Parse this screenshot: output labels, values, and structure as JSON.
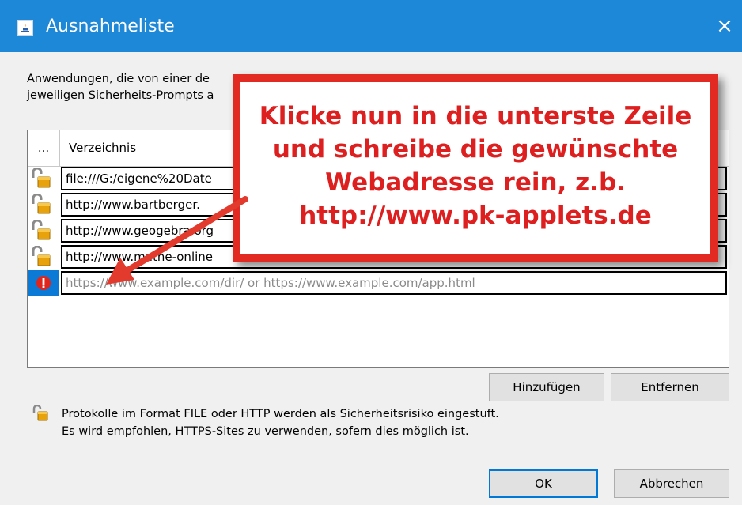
{
  "window": {
    "title": "Ausnahmeliste",
    "close_glyph": "×",
    "app_icon": "java-icon",
    "titlebar_color": "#1e88d8"
  },
  "description": "Anwendungen, die von einer de                                                                 \njeweiligen Sicherheits-Prompts a",
  "table": {
    "columns": [
      "...",
      "Verzeichnis"
    ],
    "rows": [
      {
        "icon": "unlocked-padlock-icon",
        "url": "file:///G:/eigene%20Date"
      },
      {
        "icon": "unlocked-padlock-icon",
        "url": "http://www.bartberger."
      },
      {
        "icon": "unlocked-padlock-icon",
        "url": "http://www.geogebra.org"
      },
      {
        "icon": "unlocked-padlock-icon",
        "url": "http://www.mathe-online"
      }
    ],
    "new_row": {
      "icon": "error-icon",
      "placeholder": "https://www.example.com/dir/ or https://www.example.com/app.html"
    }
  },
  "buttons": {
    "add": "Hinzufügen",
    "remove": "Entfernen",
    "ok": "OK",
    "cancel": "Abbrechen"
  },
  "warning": {
    "icon": "unlocked-padlock-icon",
    "text": "Protokolle im Format FILE oder HTTP werden als Sicherheitsrisiko eingestuft.\nEs wird empfohlen, HTTPS-Sites zu verwenden, sofern dies möglich ist."
  },
  "annotation": {
    "text": "Klicke nun in die unterste Zeile\nund schreibe die gewünschte\nWebadresse rein, z.b.\nhttp://www.pk-applets.de",
    "color": "#e32a22"
  }
}
